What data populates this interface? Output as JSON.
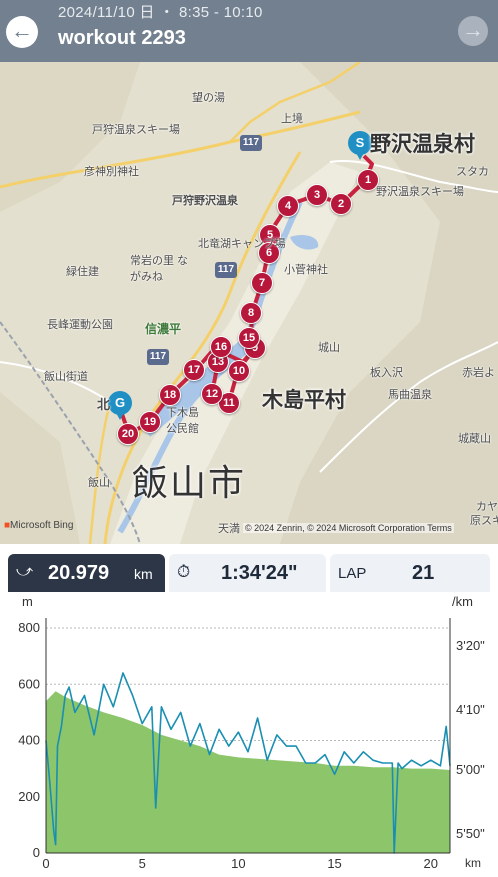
{
  "header": {
    "date": "2024/11/10 日 ・ 8:35 - 10:10",
    "title": "workout 2293",
    "back_icon": "arrow-left-icon",
    "forward_icon": "arrow-right-icon"
  },
  "map": {
    "labels": {
      "nozawa": "野沢温泉村",
      "kijimadaira": "木島平村",
      "iiyama": "飯山市",
      "togari_ski": "戸狩温泉スキー場",
      "togari_nozawa": "戸狩野沢温泉",
      "hikobetsu": "彦神別神社",
      "nozomi": "望の湯",
      "kamisakai": "上境",
      "hokuryuko": "北竜湖キャンプ場",
      "kosuge": "小菅神社",
      "tokiwa": "常岩の里 ながみね",
      "ryokuhaken": "緑住建",
      "nagamine_park": "長峰運動公園",
      "shinanodaira": "信濃平",
      "iiyama_kaido": "飯山街道",
      "shimokijima": "下木島 公民館",
      "jozan": "城山",
      "itairisawa": "板入沢",
      "umabiki": "馬曲温泉",
      "akaiwa": "赤岩よ",
      "jokizan": "城蔵山",
      "nozawa_ski": "野沢温泉スキー場",
      "sukaka": "スタカ",
      "iiyama_st": "飯山",
      "kita": "北",
      "tenman": "天満",
      "kaya": "カヤ",
      "haraska": "原スキャ",
      "iiyama_kaido2": "飯山街道"
    },
    "road_117": "117",
    "ms_bing": "Microsoft Bing",
    "copyright": "© 2024 Zenrin, © 2024 Microsoft Corporation   Terms",
    "markers": [
      "1",
      "2",
      "3",
      "4",
      "5",
      "6",
      "7",
      "8",
      "9",
      "10",
      "11",
      "12",
      "13",
      "15",
      "16",
      "17",
      "18",
      "19",
      "20"
    ],
    "start_pin": "S",
    "goal_pin": "G"
  },
  "stats": {
    "distance_icon": "route-icon",
    "distance": "20.979",
    "distance_unit": "km",
    "time_icon": "stopwatch-icon",
    "time": "1:34'24\"",
    "lap_label": "LAP",
    "lap": "21"
  },
  "chart_data": {
    "type": "area",
    "left_axis_unit": "m",
    "right_axis_unit": "/km",
    "x_unit": "km",
    "xlim": [
      0,
      21
    ],
    "ylim": [
      0,
      800
    ],
    "x_ticks": [
      "0",
      "5",
      "10",
      "15",
      "20"
    ],
    "y_ticks": [
      "0",
      "200",
      "400",
      "600",
      "800"
    ],
    "pace_ticks": [
      "3'20\"",
      "4'10\"",
      "5'00\"",
      "5'50\""
    ],
    "grid": true,
    "elevation": {
      "x": [
        0,
        0.5,
        1,
        1.5,
        2,
        3,
        4,
        5,
        6,
        7,
        8,
        9,
        10,
        11,
        12,
        13,
        14,
        15,
        16,
        17,
        18,
        19,
        20,
        21
      ],
      "values": [
        540,
        575,
        555,
        540,
        525,
        500,
        480,
        455,
        420,
        400,
        380,
        350,
        340,
        335,
        330,
        325,
        320,
        310,
        310,
        305,
        305,
        300,
        300,
        295
      ]
    },
    "pace": {
      "x": [
        0,
        0.2,
        0.4,
        0.5,
        0.6,
        0.8,
        1.0,
        1.2,
        1.5,
        2,
        2.5,
        3,
        3.5,
        4,
        4.5,
        5,
        5.5,
        5.7,
        6,
        6.5,
        7,
        7.5,
        8,
        8.5,
        9,
        9.5,
        10,
        10.5,
        11,
        11.5,
        12,
        12.5,
        13,
        13.5,
        14,
        14.5,
        15,
        15.5,
        16,
        16.5,
        17,
        17.5,
        18,
        18.1,
        18.3,
        18.5,
        19,
        19.5,
        20,
        20.5,
        20.8,
        21
      ],
      "values": [
        400,
        250,
        80,
        30,
        380,
        450,
        560,
        590,
        500,
        560,
        420,
        600,
        520,
        640,
        560,
        460,
        520,
        160,
        520,
        440,
        500,
        380,
        460,
        350,
        440,
        380,
        430,
        360,
        480,
        330,
        420,
        380,
        380,
        320,
        320,
        350,
        280,
        360,
        320,
        360,
        330,
        320,
        320,
        0,
        320,
        300,
        330,
        310,
        330,
        310,
        450,
        310
      ]
    }
  }
}
